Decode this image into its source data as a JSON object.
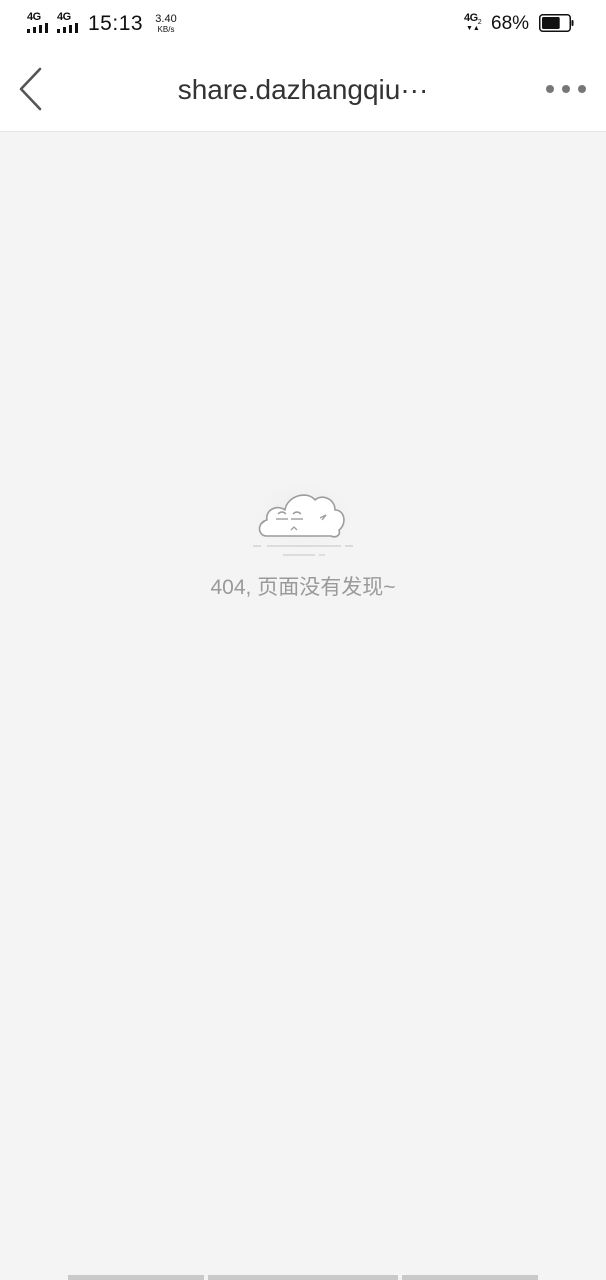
{
  "status_bar": {
    "signal_1": "4G",
    "signal_2": "4G",
    "time": "15:13",
    "speed_value": "3.40",
    "speed_unit": "KB/s",
    "network": "4G",
    "network_sub": "2",
    "battery_percent": "68%",
    "battery_level": 0.68,
    "text_color": "#111111"
  },
  "nav": {
    "back_icon": "chevron-left-icon",
    "title": "share.dazhangqiu···",
    "more_icon": "more-dots-icon"
  },
  "content": {
    "illustration_icon": "cloud-face-icon",
    "message": "404, 页面没有发现~"
  },
  "colors": {
    "page_background": "#f4f4f4",
    "header_background": "#ffffff",
    "message_text": "#9a9a9a",
    "icon_gray": "#888888"
  }
}
